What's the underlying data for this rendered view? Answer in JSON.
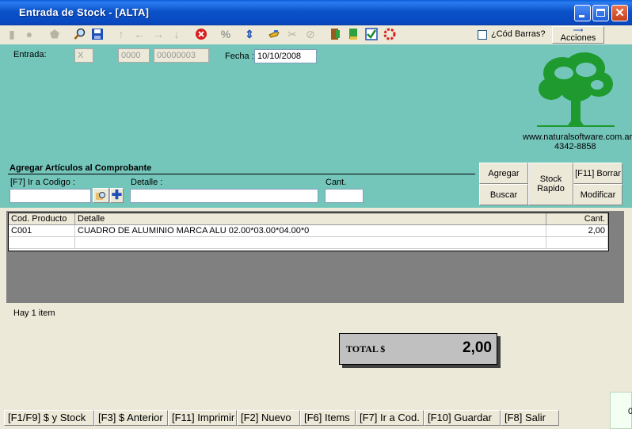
{
  "window": {
    "title": "Entrada de Stock  - [ALTA]"
  },
  "toolbar": {
    "barcode_label": "¿Cód Barras?",
    "actions_label": "Acciones"
  },
  "header": {
    "entrada_label": "Entrada:",
    "entrada_type": "X",
    "entrada_point": "0000",
    "entrada_number": "00000003",
    "fecha_label": "Fecha :",
    "fecha_value": "10/10/2008"
  },
  "company": {
    "website": "www.naturalsoftware.com.ar",
    "phone": "4342-8858"
  },
  "add_section": {
    "title": "Agregar Artículos al Comprobante",
    "code_label": "[F7] Ir a Codigo :",
    "detail_label": "Detalle :",
    "qty_label": "Cant.",
    "code_value": "",
    "detail_value": "",
    "qty_value": ""
  },
  "buttons": {
    "agregar": "Agregar",
    "buscar": "Buscar",
    "stock_rapido_1": "Stock",
    "stock_rapido_2": "Rapido",
    "borrar": "[F11] Borrar",
    "modificar": "Modificar"
  },
  "grid": {
    "columns": [
      "Cod. Producto",
      "Detalle",
      "Cant."
    ],
    "rows": [
      {
        "code": "C001",
        "detail": "CUADRO DE ALUMINIO MARCA ALU 02.00*03.00*04.00*0",
        "qty": "2,00"
      }
    ]
  },
  "status": {
    "items_text": "Hay 1 item"
  },
  "total": {
    "label": "TOTAL $",
    "value": "2,00"
  },
  "function_keys": [
    "[F1/F9] $ y Stock",
    "[F3] $ Anterior",
    "[F11] Imprimir",
    "[F2] Nuevo",
    "[F6] Items",
    "[F7] Ir a Cod.",
    "[F10] Guardar",
    "[F8] Salir"
  ],
  "corner_text": "0",
  "colors": {
    "panel": "#74C6BB",
    "grid_bg": "#808080",
    "logo": "#1E9A2E",
    "titlebar": "#0A52C8"
  }
}
